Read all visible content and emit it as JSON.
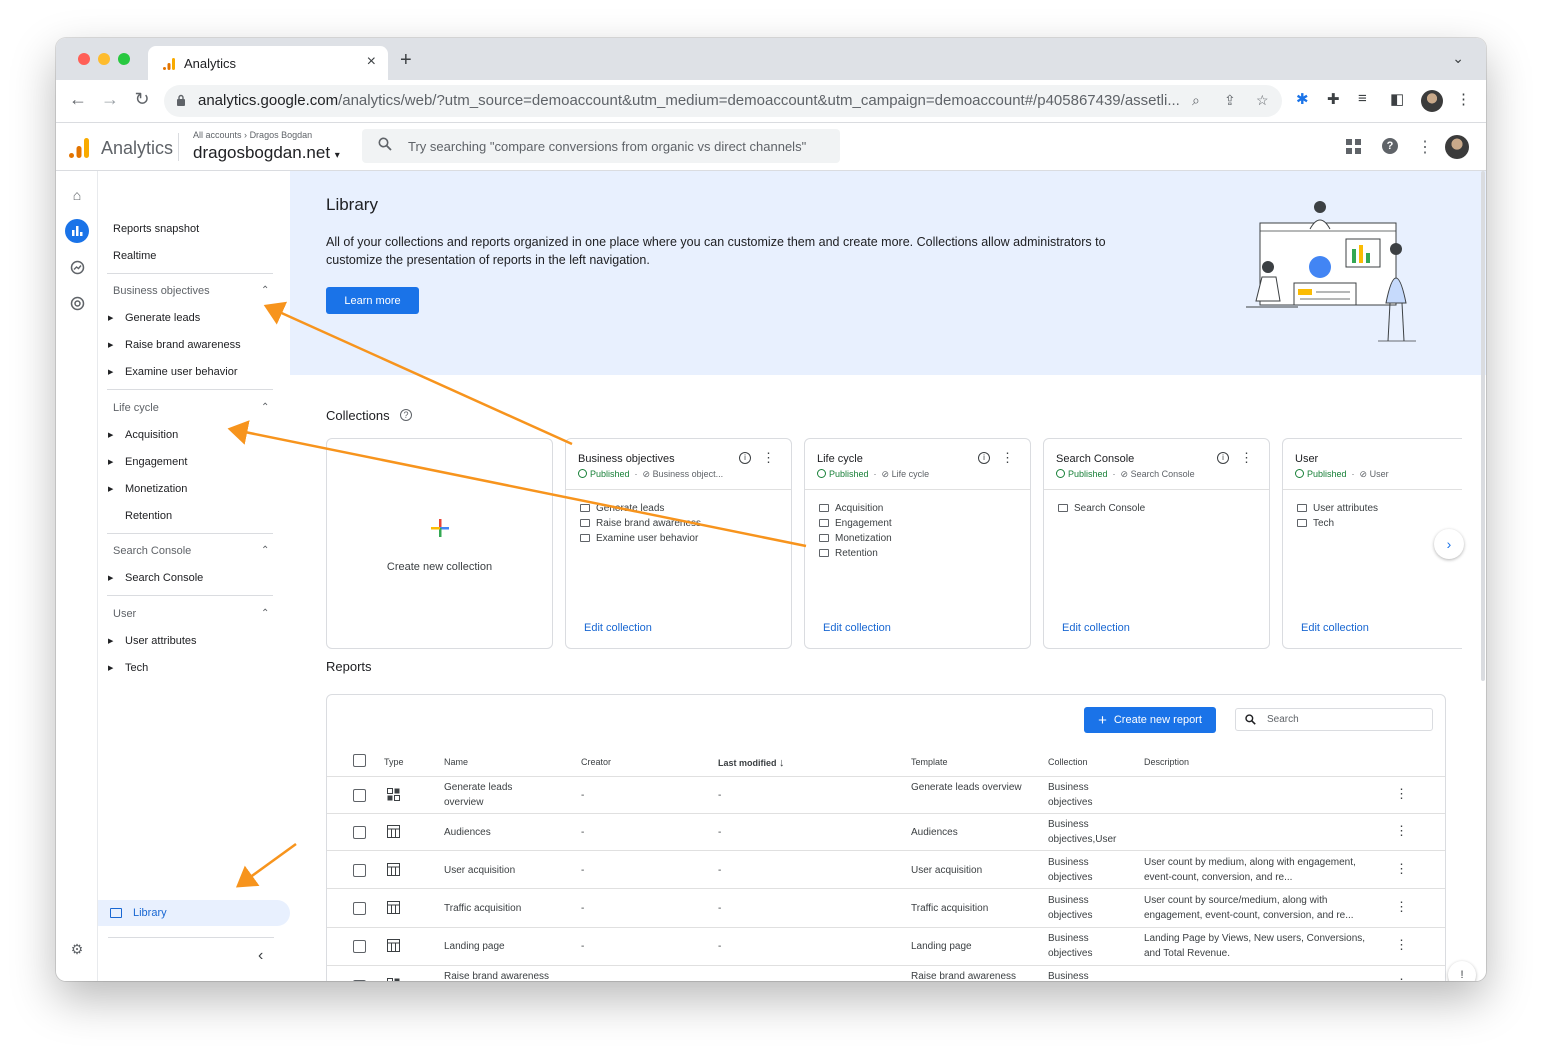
{
  "browser": {
    "tab_title": "Analytics",
    "url_host": "analytics.google.com",
    "url_path": "/analytics/web/?utm_source=demoaccount&utm_medium=demoaccount&utm_campaign=demoaccount#/p405867439/assetli..."
  },
  "header": {
    "app_name": "Analytics",
    "breadcrumb_all": "All accounts",
    "breadcrumb_account": "Dragos Bogdan",
    "property": "dragosbogdan.net",
    "search_placeholder": "Try searching \"compare conversions from organic vs direct channels\""
  },
  "nav": {
    "reports_snapshot": "Reports snapshot",
    "realtime": "Realtime",
    "sections": [
      {
        "title": "Business objectives",
        "items": [
          "Generate leads",
          "Raise brand awareness",
          "Examine user behavior"
        ]
      },
      {
        "title": "Life cycle",
        "items": [
          "Acquisition",
          "Engagement",
          "Monetization",
          "Retention"
        ]
      },
      {
        "title": "Search Console",
        "items": [
          "Search Console"
        ]
      },
      {
        "title": "User",
        "items": [
          "User attributes",
          "Tech"
        ]
      }
    ],
    "library": "Library"
  },
  "hero": {
    "title": "Library",
    "description": "All of your collections and reports organized in one place where you can customize them and create more. Collections allow administrators to customize the presentation of reports in the left navigation.",
    "learn_more": "Learn more"
  },
  "collections": {
    "title": "Collections",
    "create_label": "Create new collection",
    "cards": [
      {
        "title": "Business objectives",
        "status": "Published",
        "template": "Business object...",
        "items": [
          "Generate leads",
          "Raise brand awareness",
          "Examine user behavior"
        ],
        "edit": "Edit collection"
      },
      {
        "title": "Life cycle",
        "status": "Published",
        "template": "Life cycle",
        "items": [
          "Acquisition",
          "Engagement",
          "Monetization",
          "Retention"
        ],
        "edit": "Edit collection"
      },
      {
        "title": "Search Console",
        "status": "Published",
        "template": "Search Console",
        "items": [
          "Search Console"
        ],
        "edit": "Edit collection"
      },
      {
        "title": "User",
        "status": "Published",
        "template": "User",
        "items": [
          "User attributes",
          "Tech"
        ],
        "edit": "Edit collection"
      }
    ]
  },
  "reports": {
    "title": "Reports",
    "create_button": "Create new report",
    "search_placeholder": "Search",
    "columns": {
      "type": "Type",
      "name": "Name",
      "creator": "Creator",
      "last_modified": "Last modified",
      "template": "Template",
      "collection": "Collection",
      "description": "Description"
    },
    "rows": [
      {
        "name": "Generate leads overview",
        "creator": "-",
        "modified": "-",
        "template": "Generate leads overview",
        "collection": "Business objectives",
        "description": "",
        "icon": "overview-icon"
      },
      {
        "name": "Audiences",
        "creator": "-",
        "modified": "-",
        "template": "Audiences",
        "collection": "Business objectives,User",
        "description": "",
        "icon": "table-icon"
      },
      {
        "name": "User acquisition",
        "creator": "-",
        "modified": "-",
        "template": "User acquisition",
        "collection": "Business objectives",
        "description": "User count by medium, along with engagement, event-count, conversion, and re...",
        "icon": "table-icon"
      },
      {
        "name": "Traffic acquisition",
        "creator": "-",
        "modified": "-",
        "template": "Traffic acquisition",
        "collection": "Business objectives",
        "description": "User count by source/medium, along with engagement, event-count, conversion, and re...",
        "icon": "table-icon"
      },
      {
        "name": "Landing page",
        "creator": "-",
        "modified": "-",
        "template": "Landing page",
        "collection": "Business objectives",
        "description": "Landing Page by Views, New users, Conversions, and Total Revenue.",
        "icon": "table-icon"
      },
      {
        "name": "Raise brand awareness",
        "creator": "",
        "modified": "",
        "template": "Raise brand awareness",
        "collection": "Business",
        "description": "",
        "icon": "overview-icon"
      }
    ]
  },
  "colors": {
    "accent": "#1a73e8",
    "hero_bg": "#e8f0fe",
    "published": "#188038",
    "annotation_arrow": "#f7941d"
  }
}
